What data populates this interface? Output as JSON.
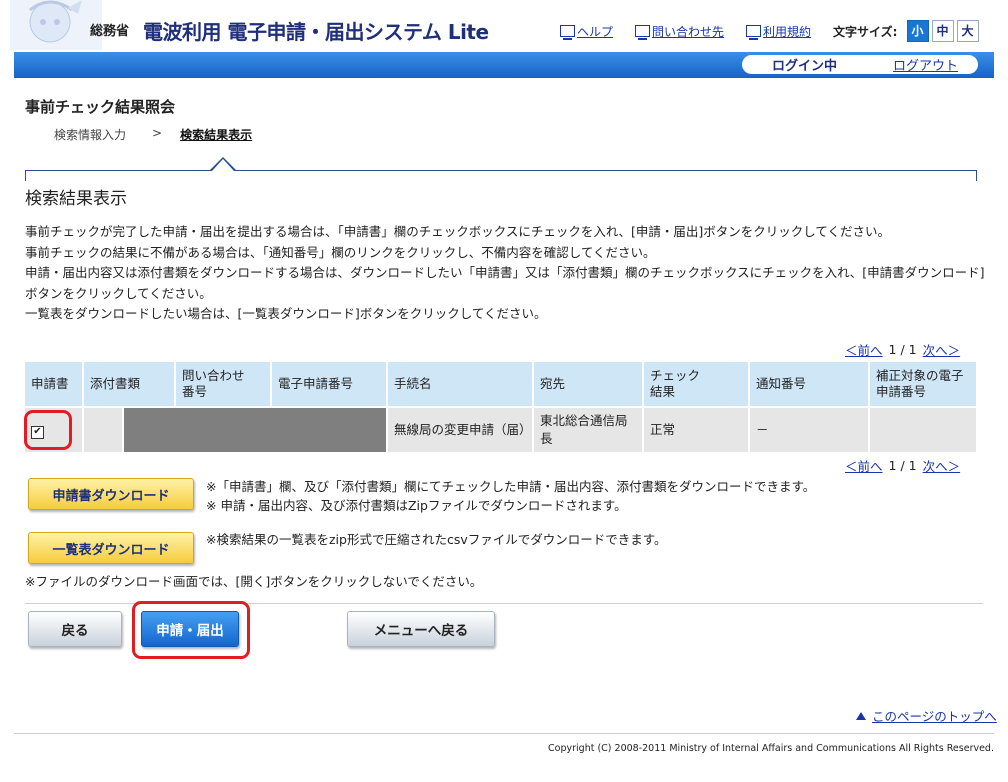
{
  "header": {
    "agency": "総務省",
    "system_title": "電波利用 電子申請・届出システム Lite",
    "links": [
      {
        "label": "ヘルプ"
      },
      {
        "label": "問い合わせ先"
      },
      {
        "label": "利用規約"
      }
    ],
    "font_size_label": "文字サイズ:",
    "font_sizes": [
      "小",
      "中",
      "大"
    ],
    "login_status": "ログイン中",
    "logout": "ログアウト"
  },
  "page": {
    "title": "事前チェック結果照会",
    "breadcrumb": [
      "検索情報入力",
      "検索結果表示"
    ],
    "breadcrumb_sep": ">",
    "section_title": "検索結果表示",
    "description": [
      "事前チェックが完了した申請・届出を提出する場合は、「申請書」欄のチェックボックスにチェックを入れ、[申請・届出]ボタンをクリックしてください。",
      "事前チェックの結果に不備がある場合は、「通知番号」欄のリンクをクリックし、不備内容を確認してください。",
      "申請・届出内容又は添付書類をダウンロードする場合は、ダウンロードしたい「申請書」又は「添付書類」欄のチェックボックスにチェックを入れ、[申請書ダウンロード]",
      "ボタンをクリックしてください。",
      "一覧表をダウンロードしたい場合は、[一覧表ダウンロード]ボタンをクリックしてください。"
    ]
  },
  "pager": {
    "prev": "＜前へ",
    "count": "1 / 1",
    "next": "次へ＞"
  },
  "table": {
    "headers": [
      "申請書",
      "添付書類",
      "問い合わせ\n番号",
      "電子申請番号",
      "手続名",
      "宛先",
      "チェック\n結果",
      "通知番号",
      "補正対象の電子\n申請番号"
    ],
    "rows": [
      {
        "checked": true,
        "attachment": "",
        "inquiry_no": "",
        "e_app_no": "",
        "procedure": "無線局の変更申請（届）",
        "destination": "東北総合通信局長",
        "result": "正常",
        "notice_no": "－",
        "correction_no": ""
      }
    ]
  },
  "downloads": {
    "app_btn": "申請書ダウンロード",
    "app_note1": "※「申請書」欄、及び「添付書類」欄にてチェックした申請・届出内容、添付書類をダウンロードできます。",
    "app_note2": "※ 申請・届出内容、及び添付書類はZipファイルでダウンロードされます。",
    "list_btn": "一覧表ダウンロード",
    "list_note": "※検索結果の一覧表をzip形式で圧縮されたcsvファイルでダウンロードできます。",
    "file_note": "※ファイルのダウンロード画面では、[開く]ボタンをクリックしないでください。"
  },
  "actions": {
    "back": "戻る",
    "submit": "申請・届出",
    "menu": "メニューへ戻る"
  },
  "footer": {
    "pagetop": "このページのトップへ",
    "copyright": "Copyright (C) 2008-2011 Ministry of Internal Affairs and Communications All Rights Reserved."
  },
  "colors": {
    "accent_blue": "#1877d6",
    "highlight_red": "#e31b23",
    "download_yellow": "#f6cc3c",
    "header_cell": "#cfe6f7"
  }
}
